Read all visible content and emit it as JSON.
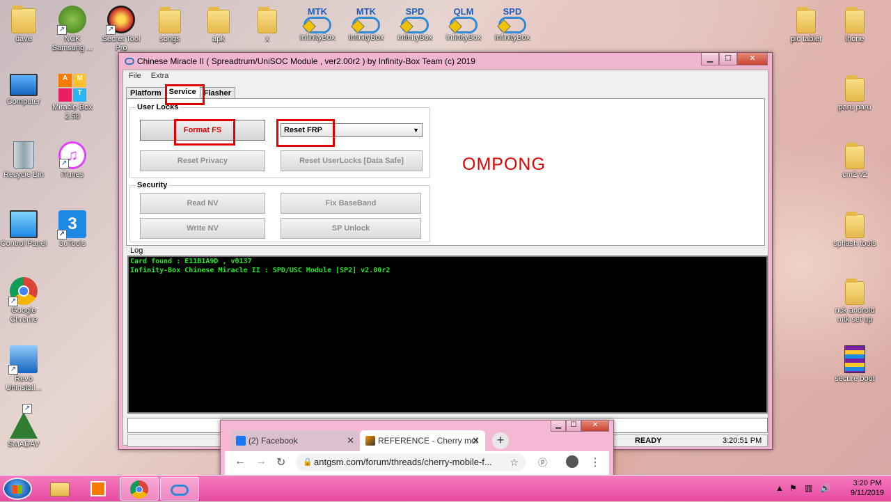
{
  "desktop": {
    "left_icons": [
      {
        "label": "dave"
      },
      {
        "label": "NCK Samsung ..."
      },
      {
        "label": "Secret Tool Pro"
      },
      {
        "label": "songs"
      },
      {
        "label": "apk"
      },
      {
        "label": "x"
      },
      {
        "label": "Computer"
      },
      {
        "label": "Miracle Box 2.58"
      },
      {
        "label": "Recycle Bin"
      },
      {
        "label": "iTunes"
      },
      {
        "label": "Control Panel"
      },
      {
        "label": "3uTools"
      },
      {
        "label": "Google Chrome"
      },
      {
        "label": "Revo Uninstall..."
      },
      {
        "label": "SMADAV"
      }
    ],
    "infinity_icons": [
      {
        "badge": "MTK",
        "label": "InfinityBox"
      },
      {
        "badge": "MTK",
        "label": "InfinityBox"
      },
      {
        "badge": "SPD",
        "label": "InfinityBox"
      },
      {
        "badge": "QLM",
        "label": "InfinityBox"
      },
      {
        "badge": "SPD",
        "label": "InfinityBox"
      }
    ],
    "right_icons": [
      {
        "label": "pic tablet"
      },
      {
        "label": "ihone"
      },
      {
        "label": "paru paru"
      },
      {
        "label": "cm2 v2"
      },
      {
        "label": "spflash tools"
      },
      {
        "label": "nck android mtk set up"
      },
      {
        "label": "secure boot"
      }
    ]
  },
  "window": {
    "title": "Chinese Miracle II ( Spreadtrum/UniSOC Module , ver2.00r2  ) by Infinity-Box Team (c) 2019",
    "minimize": "▁",
    "maximize": "☐",
    "close": "✕",
    "menu": {
      "file": "File",
      "extra": "Extra"
    },
    "tabs": {
      "platform": "Platform",
      "service": "Service",
      "flasher": "Flasher"
    },
    "user_locks": {
      "title": "User Locks",
      "format_fs": "Format FS",
      "reset_frp": "Reset FRP",
      "reset_privacy": "Reset Privacy",
      "reset_userlocks": "Reset UserLocks [Data Safe]"
    },
    "security": {
      "title": "Security",
      "read_nv": "Read NV",
      "fix_baseband": "Fix BaseBand",
      "write_nv": "Write NV",
      "sp_unlock": "SP Unlock"
    },
    "annotation": "OMPONG",
    "log_label": "Log",
    "log_lines": [
      "Card found : E11B1A9D , v0137",
      "Infinity-Box Chinese Miracle II : SPD/USC Module [SP2] v2.00r2"
    ],
    "status": {
      "state": "READY",
      "time": "3:20:51 PM"
    }
  },
  "chrome": {
    "tab1": "(2) Facebook",
    "tab2": "REFERENCE - Cherry mol",
    "url": "antgsm.com/forum/threads/cherry-mobile-f..."
  },
  "taskbar": {
    "time": "3:20 PM",
    "date": "9/11/2019"
  },
  "colors": {
    "annotation_red": "#e00000",
    "log_green": "#27e627",
    "taskbar_pink": "#e64aa2"
  }
}
